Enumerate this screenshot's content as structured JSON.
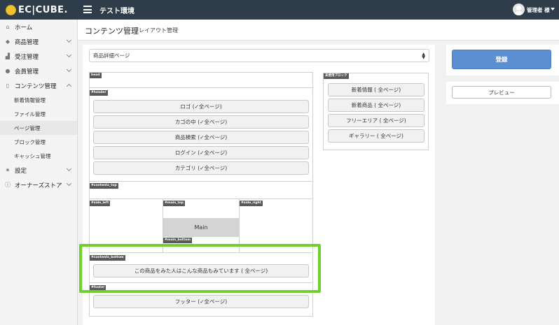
{
  "header": {
    "logo_text": "EC|CUBE.",
    "shop_name": "テスト環境",
    "user_name": "管理者 様"
  },
  "sidebar": {
    "items": [
      {
        "label": "ホーム",
        "icon": "home-icon"
      },
      {
        "label": "商品管理",
        "icon": "tag-icon"
      },
      {
        "label": "受注管理",
        "icon": "cart-icon"
      },
      {
        "label": "会員管理",
        "icon": "users-icon"
      },
      {
        "label": "コンテンツ管理",
        "icon": "file-icon"
      },
      {
        "label": "設定",
        "icon": "gear-icon"
      },
      {
        "label": "オーナーズストア",
        "icon": "info-icon"
      }
    ],
    "content_sub": [
      "新着情報管理",
      "ファイル管理",
      "ページ管理",
      "ブロック管理",
      "キャッシュ管理"
    ]
  },
  "page": {
    "title": "コンテンツ管理",
    "subtitle": "レイアウト管理"
  },
  "layout": {
    "page_select_value": "商品詳細ページ",
    "sections": {
      "head": "head",
      "header": "#header",
      "contents_top": "#contents_top",
      "side_left": "#side_left",
      "main_top": "#main_top",
      "side_right": "#side_right",
      "main_bottom": "#main_bottom",
      "contents_bottom": "#contents_bottom",
      "footer": "#footer"
    },
    "main_label": "Main",
    "header_blocks": [
      "ロゴ (✓全ページ)",
      "カゴの中 (✓全ページ)",
      "商品検索 (✓全ページ)",
      "ログイン (✓全ページ)",
      "カテゴリ (✓全ページ)"
    ],
    "contents_bottom_blocks": [
      "この商品をみた人はこんな商品もみています (  全ページ)"
    ],
    "footer_blocks": [
      "フッター (✓全ページ)"
    ]
  },
  "unused": {
    "label": "未使用ブロック",
    "blocks": [
      "新着情報 (  全ページ)",
      "新着商品 (  全ページ)",
      "フリーエリア (  全ページ)",
      "ギャラリー (  全ページ)"
    ]
  },
  "actions": {
    "register_label": "登録",
    "preview_label": "プレビュー"
  },
  "colors": {
    "topbar": "#2f3d4a",
    "register_button": "#5c8fd1",
    "highlight": "#6fd02f"
  }
}
